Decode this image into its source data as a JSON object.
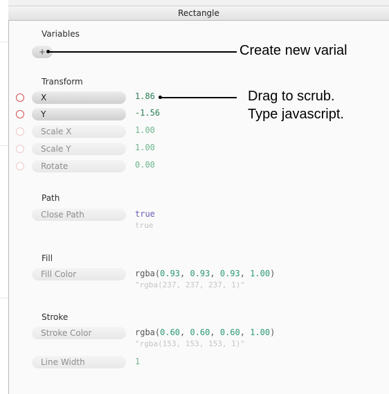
{
  "panel_title": "Rectangle",
  "variables": {
    "title": "Variables",
    "add_label": "+"
  },
  "transform": {
    "title": "Transform",
    "rows": [
      {
        "label": "X",
        "value": "1.86"
      },
      {
        "label": "Y",
        "value": "-1.56"
      },
      {
        "label": "Scale X",
        "value": "1.00"
      },
      {
        "label": "Scale Y",
        "value": "1.00"
      },
      {
        "label": "Rotate",
        "value": "0.00"
      }
    ]
  },
  "path": {
    "title": "Path",
    "close_label": "Close Path",
    "value": "true",
    "computed": "true"
  },
  "fill": {
    "title": "Fill",
    "label": "Fill Color",
    "value_prefix": "rgba(",
    "values": [
      "0.93",
      "0.93",
      "0.93",
      "1.00"
    ],
    "computed": "\"rgba(237, 237, 237, 1)\""
  },
  "stroke": {
    "title": "Stroke",
    "label": "Stroke Color",
    "value_prefix": "rgba(",
    "values": [
      "0.60",
      "0.60",
      "0.60",
      "1.00"
    ],
    "computed": "\"rgba(153, 153, 153, 1)\"",
    "width_label": "Line Width",
    "width_value": "1"
  },
  "annotations": {
    "create_var": "Create new varial",
    "drag_line1": "Drag to scrub.",
    "drag_line2": "Type javascript."
  },
  "colors": {
    "dark_value": "#2c7f55",
    "light_value": "#6fb58c",
    "bool_value": "#6b5bb3",
    "circle": "#d24d4d"
  }
}
